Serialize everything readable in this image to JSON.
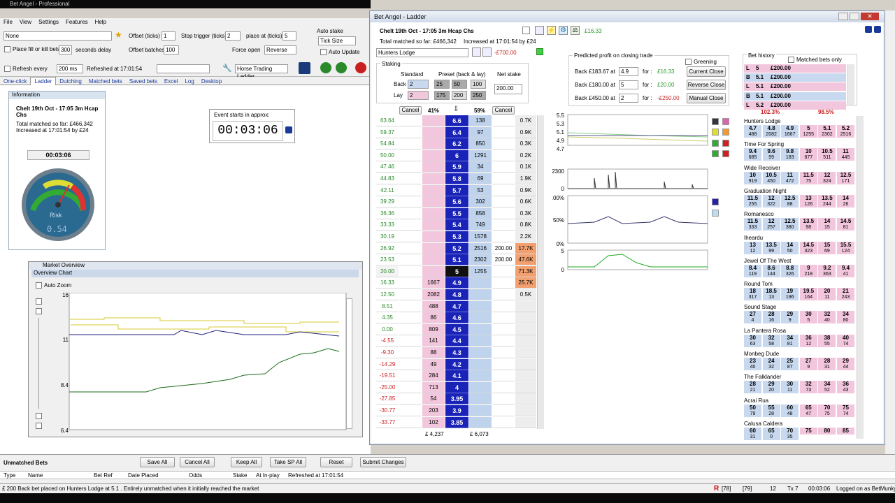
{
  "app": {
    "title": "Bet Angel - Professional",
    "menu": [
      "File",
      "View",
      "Settings",
      "Features",
      "Help"
    ]
  },
  "toolbar": {
    "market_select": "None",
    "offset_ticks_label": "Offset (ticks)",
    "offset_ticks": "1",
    "stop_trigger_label": "Stop trigger (ticks)",
    "stop_trigger": "2",
    "place_at_label": "place at (ticks)",
    "place_at": "5",
    "auto_stake_label": "Auto stake",
    "auto_stake_value": "Tick Size",
    "place_fill_label": "Place fill or kill bets",
    "fill_kill_value": "300",
    "seconds_delay": "seconds delay",
    "offset_batches_label": "Offset batches",
    "offset_batches": "100",
    "force_open_label": "Force open",
    "force_open_value": "Reverse",
    "auto_update": "Auto Update",
    "refresh_every_label": "Refresh every",
    "refresh_every": "200 ms",
    "refreshed_at": "Refreshed at 17:01:54",
    "app_select": "Horse Trading Ladder",
    "tabs": [
      "One-click",
      "Ladder",
      "Dutching",
      "Matched bets",
      "Saved bets",
      "Excel",
      "Log",
      "Desktop"
    ]
  },
  "info": {
    "header": "Information",
    "race": "Chelt 19th Oct - 17:05 3m Hcap Chs",
    "matched": "Total matched so far: £466,342",
    "increased": "Increased at 17:01:54 by £24",
    "timer": "00:03:06",
    "risk": "Risk",
    "risk_digits": "0.54"
  },
  "event_starts": {
    "label": "Event starts in approx:",
    "time": "00:03:06"
  },
  "overview": {
    "title": "Market Overview",
    "chart_title": "Overview Chart",
    "auto_zoom": "Auto Zoom",
    "y_labels": [
      "16",
      "11",
      "8.4",
      "6.4"
    ]
  },
  "ladder": {
    "title": "Bet Angel - Ladder",
    "race": "Chelt 19th Oct - 17:05 3m Hcap Chs",
    "matched": "Total matched so far: £466,342",
    "increased": "Increased at 17:01:54 by £24",
    "pl_top": "£16.33",
    "runner": "Hunters Lodge",
    "runner_pl": "-£700.00",
    "staking_title": "Staking",
    "standard": "Standard",
    "preset": "Preset (back & lay)",
    "net_stake": "Net stake",
    "back_label": "Back",
    "lay_label": "Lay",
    "back_std": "2",
    "lay_std": "2",
    "back_presets": [
      "25",
      "50",
      "100"
    ],
    "lay_presets": [
      "175",
      "200",
      "250"
    ],
    "net_value": "200.00",
    "cancel": "Cancel",
    "pct_back": "41%",
    "pct_lay": "59%",
    "foot_left": "£ 4,237",
    "foot_right": "£ 6,073",
    "rows": [
      {
        "pl": "63.64",
        "bv": "",
        "price": "6.6",
        "lv": "138",
        "vol": "0.7K"
      },
      {
        "pl": "59.37",
        "bv": "",
        "price": "6.4",
        "lv": "97",
        "vol": "0.9K"
      },
      {
        "pl": "54.84",
        "bv": "",
        "price": "6.2",
        "lv": "850",
        "vol": "0.3K"
      },
      {
        "pl": "50.00",
        "bv": "",
        "price": "6",
        "lv": "1291",
        "vol": "0.2K"
      },
      {
        "pl": "47.46",
        "bv": "",
        "price": "5.9",
        "lv": "34",
        "vol": "0.1K"
      },
      {
        "pl": "44.83",
        "bv": "",
        "price": "5.8",
        "lv": "69",
        "vol": "1.9K"
      },
      {
        "pl": "42.11",
        "bv": "",
        "price": "5.7",
        "lv": "53",
        "vol": "0.9K"
      },
      {
        "pl": "39.29",
        "bv": "",
        "price": "5.6",
        "lv": "302",
        "vol": "0.6K"
      },
      {
        "pl": "36.36",
        "bv": "",
        "price": "5.5",
        "lv": "858",
        "vol": "0.3K"
      },
      {
        "pl": "33.33",
        "bv": "",
        "price": "5.4",
        "lv": "749",
        "vol": "0.8K"
      },
      {
        "pl": "30.19",
        "bv": "",
        "price": "5.3",
        "lv": "1578",
        "vol": "2.2K"
      },
      {
        "pl": "26.92",
        "bv": "",
        "price": "5.2",
        "lv": "2516",
        "my": "200.00",
        "vol": "17.7K"
      },
      {
        "pl": "23.53",
        "bv": "",
        "price": "5.1",
        "lv": "2302",
        "my": "200.00",
        "vol": "47.6K"
      },
      {
        "pl": "20.00",
        "bv": "",
        "price": "5",
        "lv": "1255",
        "vol": "71.3K"
      },
      {
        "pl": "16.33",
        "bv": "1667",
        "price": "4.9",
        "lv": "",
        "vol": "25.7K"
      },
      {
        "pl": "12.50",
        "bv": "2082",
        "price": "4.8",
        "lv": "",
        "vol": "0.5K"
      },
      {
        "pl": "8.51",
        "bv": "488",
        "price": "4.7",
        "lv": "",
        "vol": ""
      },
      {
        "pl": "4.35",
        "bv": "86",
        "price": "4.6",
        "lv": "",
        "vol": ""
      },
      {
        "pl": "0.00",
        "bv": "809",
        "price": "4.5",
        "lv": "",
        "vol": ""
      },
      {
        "pl": "-4.55",
        "bv": "141",
        "price": "4.4",
        "lv": "",
        "vol": ""
      },
      {
        "pl": "-9.30",
        "bv": "88",
        "price": "4.3",
        "lv": "",
        "vol": ""
      },
      {
        "pl": "-14.29",
        "bv": "49",
        "price": "4.2",
        "lv": "",
        "vol": ""
      },
      {
        "pl": "-19.51",
        "bv": "284",
        "price": "4.1",
        "lv": "",
        "vol": ""
      },
      {
        "pl": "-25.00",
        "bv": "713",
        "price": "4",
        "lv": "",
        "vol": ""
      },
      {
        "pl": "-27.85",
        "bv": "54",
        "price": "3.95",
        "lv": "",
        "vol": ""
      },
      {
        "pl": "-30.77",
        "bv": "203",
        "price": "3.9",
        "lv": "",
        "vol": ""
      },
      {
        "pl": "-33.77",
        "bv": "102",
        "price": "3.85",
        "lv": "",
        "vol": ""
      }
    ]
  },
  "predicted": {
    "title": "Predicted profit on closing trade",
    "greening": "Greening",
    "rows": [
      {
        "label": "Back £183.67 at",
        "odds": "4.9",
        "for": "for :",
        "val": "£16.33",
        "btn": "Current Close"
      },
      {
        "label": "Back £180.00 at",
        "odds": "5",
        "for": "for :",
        "val": "£20.00",
        "btn": "Reverse Close"
      },
      {
        "label": "Back £450.00 at",
        "odds": "2",
        "for": "for :",
        "val": "-£250.00",
        "btn": "Manual Close"
      }
    ]
  },
  "charts": {
    "price_axis": [
      "5.5",
      "5.3",
      "5.1",
      "4.9",
      "4.7"
    ],
    "vol_axis": [
      "2300",
      "0"
    ],
    "pct_axis": [
      "100%",
      "50%",
      "0%"
    ],
    "bot_axis": [
      "5",
      "0"
    ]
  },
  "bet_history": {
    "title": "Bet history",
    "matched_only": "Matched bets only",
    "rows": [
      {
        "t": "L",
        "o": "5",
        "s": "£200.00"
      },
      {
        "t": "B",
        "o": "5.1",
        "s": "£200.00"
      },
      {
        "t": "L",
        "o": "5.1",
        "s": "£200.00"
      },
      {
        "t": "B",
        "o": "5.1",
        "s": "£200.00"
      },
      {
        "t": "L",
        "o": "5.2",
        "s": "£200.00"
      }
    ],
    "pct_left": "102.3%",
    "pct_right": "98.5%"
  },
  "runners": [
    {
      "name": "Hunters Lodge",
      "p": [
        "4.7",
        "4.8",
        "4.9",
        "5",
        "5.1",
        "5.2"
      ],
      "v": [
        "488",
        "2082",
        "1667",
        "1255",
        "2302",
        "2516"
      ]
    },
    {
      "name": "Time For Spring",
      "p": [
        "9.4",
        "9.6",
        "9.8",
        "10",
        "10.5",
        "11"
      ],
      "v": [
        "685",
        "99",
        "183",
        "677",
        "511",
        "445"
      ]
    },
    {
      "name": "Wide Receiver",
      "p": [
        "10",
        "10.5",
        "11",
        "11.5",
        "12",
        "12.5"
      ],
      "v": [
        "919",
        "450",
        "472",
        "75",
        "324",
        "171"
      ]
    },
    {
      "name": "Graduation Night",
      "p": [
        "11.5",
        "12",
        "12.5",
        "13",
        "13.5",
        "14"
      ],
      "v": [
        "255",
        "322",
        "88",
        "126",
        "244",
        "26"
      ]
    },
    {
      "name": "Romanesco",
      "p": [
        "11.5",
        "12",
        "12.5",
        "13.5",
        "14",
        "14.5"
      ],
      "v": [
        "333",
        "257",
        "380",
        "98",
        "15",
        "81"
      ]
    },
    {
      "name": "Iheardu",
      "p": [
        "13",
        "13.5",
        "14",
        "14.5",
        "15",
        "15.5"
      ],
      "v": [
        "12",
        "99",
        "50",
        "323",
        "69",
        "124"
      ]
    },
    {
      "name": "Jewel Of The West",
      "p": [
        "8.4",
        "8.6",
        "8.8",
        "9",
        "9.2",
        "9.4"
      ],
      "v": [
        "119",
        "144",
        "326",
        "218",
        "363",
        "41"
      ]
    },
    {
      "name": "Round Tom",
      "p": [
        "18",
        "18.5",
        "19",
        "19.5",
        "20",
        "21"
      ],
      "v": [
        "317",
        "13",
        "196",
        "164",
        "11",
        "243"
      ]
    },
    {
      "name": "Sound Stage",
      "p": [
        "27",
        "28",
        "29",
        "30",
        "32",
        "34"
      ],
      "v": [
        "4",
        "16",
        "9",
        "5",
        "40",
        "80"
      ]
    },
    {
      "name": "La Pantera Rosa",
      "p": [
        "30",
        "32",
        "34",
        "36",
        "38",
        "40"
      ],
      "v": [
        "63",
        "58",
        "81",
        "12",
        "55",
        "74"
      ]
    },
    {
      "name": "Monbeg Dude",
      "p": [
        "23",
        "24",
        "25",
        "27",
        "28",
        "29"
      ],
      "v": [
        "40",
        "32",
        "87",
        "9",
        "31",
        "44"
      ]
    },
    {
      "name": "The Falklander",
      "p": [
        "28",
        "29",
        "30",
        "32",
        "34",
        "36"
      ],
      "v": [
        "21",
        "20",
        "11",
        "73",
        "52",
        "43"
      ]
    },
    {
      "name": "Acrai Rua",
      "p": [
        "50",
        "55",
        "60",
        "65",
        "70",
        "75"
      ],
      "v": [
        "79",
        "28",
        "48",
        "47",
        "75",
        "74"
      ]
    },
    {
      "name": "Calusa Caldera",
      "p": [
        "60",
        "65",
        "70",
        "75",
        "80",
        "85"
      ],
      "v": [
        "31",
        "0",
        "35",
        "",
        "",
        ""
      ]
    }
  ],
  "unmatched": {
    "title": "Unmatched Bets",
    "buttons": [
      "Save All",
      "Cancel All",
      "Keep All",
      "Take SP All",
      "Reset",
      "Submit Changes"
    ],
    "cols": [
      "Type",
      "Name",
      "Bet Ref",
      "Date Placed",
      "Odds",
      "Stake",
      "At In-play",
      "Refreshed at 17:01:54"
    ]
  },
  "status": {
    "message": "£ 200 Back bet placed on Hunters Lodge at 5.1 . Entirely unmatched when it initially reached the market",
    "r": "R",
    "c1": "[78]",
    "c2": "[79]",
    "n": "12",
    "tx": "Tx 7",
    "time": "00:03:06",
    "logged": "Logged on as BetMunky"
  },
  "colors": {
    "price_blue": "#1a23b8",
    "back_pink": "#f2c6dc",
    "lay_blue": "#bfd3ec",
    "vol_orange": "#f2a070",
    "green": "#2a9a2a",
    "red": "#cc2222"
  }
}
